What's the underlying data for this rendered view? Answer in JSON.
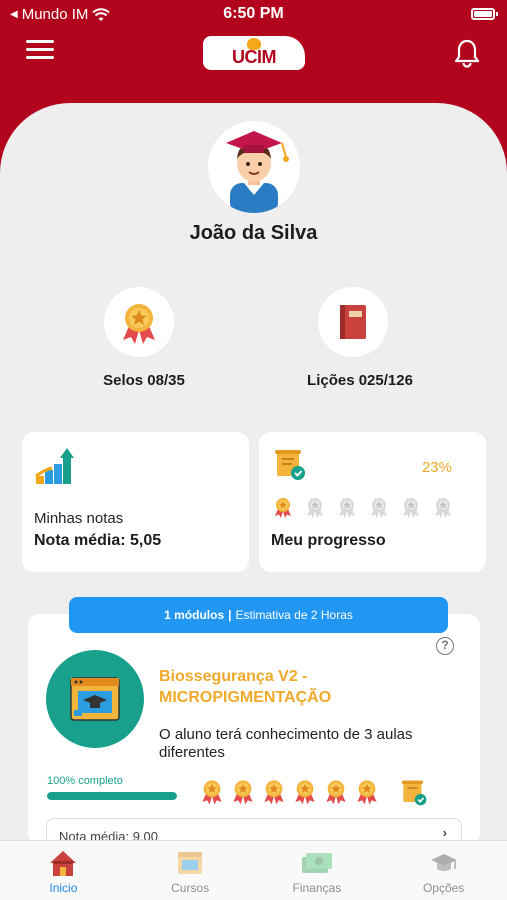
{
  "status": {
    "carrier": "Mundo IM",
    "time": "6:50 PM"
  },
  "app": {
    "logo_text": "UCIM"
  },
  "user": {
    "name": "João da Silva"
  },
  "stats": [
    {
      "label": "Selos 08/35",
      "icon": "medal-icon"
    },
    {
      "label": "Lições 025/126",
      "icon": "book-icon"
    }
  ],
  "notes_card": {
    "caption": "Minhas notas",
    "value": "Nota média: 5,05",
    "icon": "chart-growth-icon"
  },
  "progress_card": {
    "title": "Meu progresso",
    "percent": "23%",
    "earned_medals": 1,
    "total_medals": 6,
    "icon": "certificate-icon"
  },
  "course": {
    "banner_modules": "1 módulos",
    "banner_separator": "|",
    "banner_estimate": "Estimativa de 2 Horas",
    "title": "Biossegurança V2 - MICROPIGMENTAÇÃO",
    "description": "O aluno terá conhecimento de 3 aulas diferentes",
    "complete_label": "100% completo",
    "progress": 1.0,
    "medals": 6,
    "footer_partial": "Nota média: 9,00"
  },
  "tabs": [
    {
      "label": "Inicio",
      "icon": "home-icon",
      "active": true
    },
    {
      "label": "Cursos",
      "icon": "courses-icon",
      "active": false
    },
    {
      "label": "Finanças",
      "icon": "finance-icon",
      "active": false
    },
    {
      "label": "Opções",
      "icon": "graduation-cap-icon",
      "active": false
    }
  ],
  "colors": {
    "brand": "#b3041d",
    "accent": "#f0a92b",
    "teal": "#18a08c",
    "blue": "#2196f3",
    "active_tab": "#1e88e5"
  }
}
